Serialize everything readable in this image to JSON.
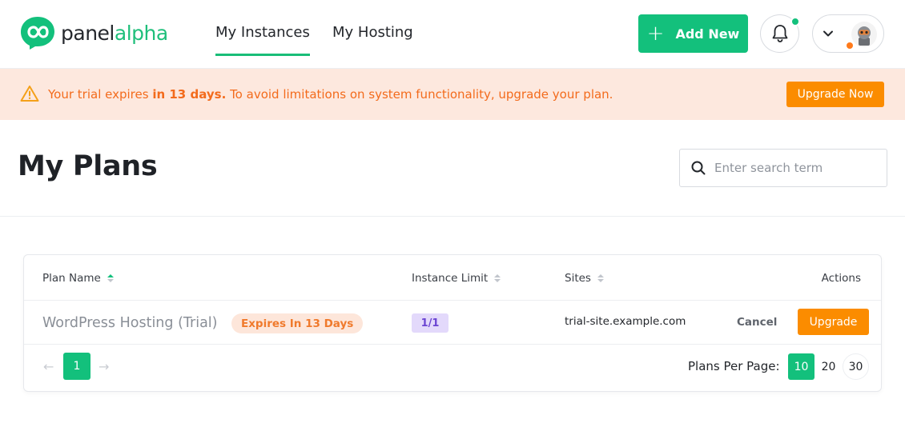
{
  "brand": {
    "name_part1": "panel",
    "name_part2": "alpha",
    "accent": "#13c07c"
  },
  "nav": {
    "tabs": [
      {
        "label": "My Instances",
        "active": true
      },
      {
        "label": "My Hosting",
        "active": false
      }
    ]
  },
  "header": {
    "add_new_label": "Add New",
    "add_new_icon": "plus-icon",
    "bell_icon": "bell-icon",
    "user_chevron_icon": "chevron-down-icon"
  },
  "banner": {
    "icon": "warning-icon",
    "text_before": "Your trial expires",
    "text_bold": "in 13 days.",
    "text_after": "To avoid limitations on system functionality, upgrade your plan.",
    "button_label": "Upgrade Now",
    "bg_color": "#fde8de",
    "text_color": "#f36b1c",
    "button_color": "#fb8c00"
  },
  "page": {
    "title": "My Plans",
    "search_placeholder": "Enter search term"
  },
  "table": {
    "columns": [
      {
        "label": "Plan Name",
        "sortable": true,
        "sorted": "asc"
      },
      {
        "label": "Instance Limit",
        "sortable": true
      },
      {
        "label": "Sites",
        "sortable": true
      },
      {
        "label": "Actions",
        "sortable": false
      }
    ],
    "rows": [
      {
        "plan_name": "WordPress Hosting (Trial)",
        "badge": "Expires In 13 Days",
        "instance_limit": "1/1",
        "site": "trial-site.example.com",
        "cancel_label": "Cancel",
        "upgrade_label": "Upgrade"
      }
    ]
  },
  "pagination": {
    "prev": "←",
    "current_page": "1",
    "next": "→",
    "per_page_label": "Plans Per Page:",
    "per_page_options": [
      "10",
      "20",
      "30"
    ],
    "per_page_selected": "10"
  }
}
